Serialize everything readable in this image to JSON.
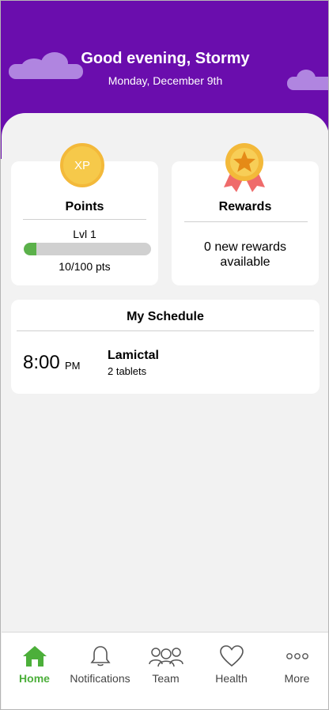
{
  "header": {
    "greeting": "Good evening, Stormy",
    "date": "Monday, December 9th"
  },
  "points_card": {
    "badge": "XP",
    "title": "Points",
    "level": "Lvl 1",
    "progress_text": "10/100 pts",
    "progress_fraction": 0.1
  },
  "rewards_card": {
    "title": "Rewards",
    "status": "0 new rewards available"
  },
  "schedule": {
    "title": "My Schedule",
    "items": [
      {
        "time": "8:00",
        "period": "PM",
        "medication": "Lamictal",
        "dose": "2 tablets"
      }
    ]
  },
  "tabs": [
    {
      "label": "Home",
      "icon": "home-icon",
      "active": true
    },
    {
      "label": "Notifications",
      "icon": "bell-icon",
      "active": false
    },
    {
      "label": "Team",
      "icon": "team-icon",
      "active": false
    },
    {
      "label": "Health",
      "icon": "heart-icon",
      "active": false
    },
    {
      "label": "More",
      "icon": "more-icon",
      "active": false
    }
  ],
  "colors": {
    "header": "#6a0dad",
    "accent": "#5bb14a",
    "badge_gold": "#f6c94a",
    "ribbon": "#ef6b6b"
  }
}
